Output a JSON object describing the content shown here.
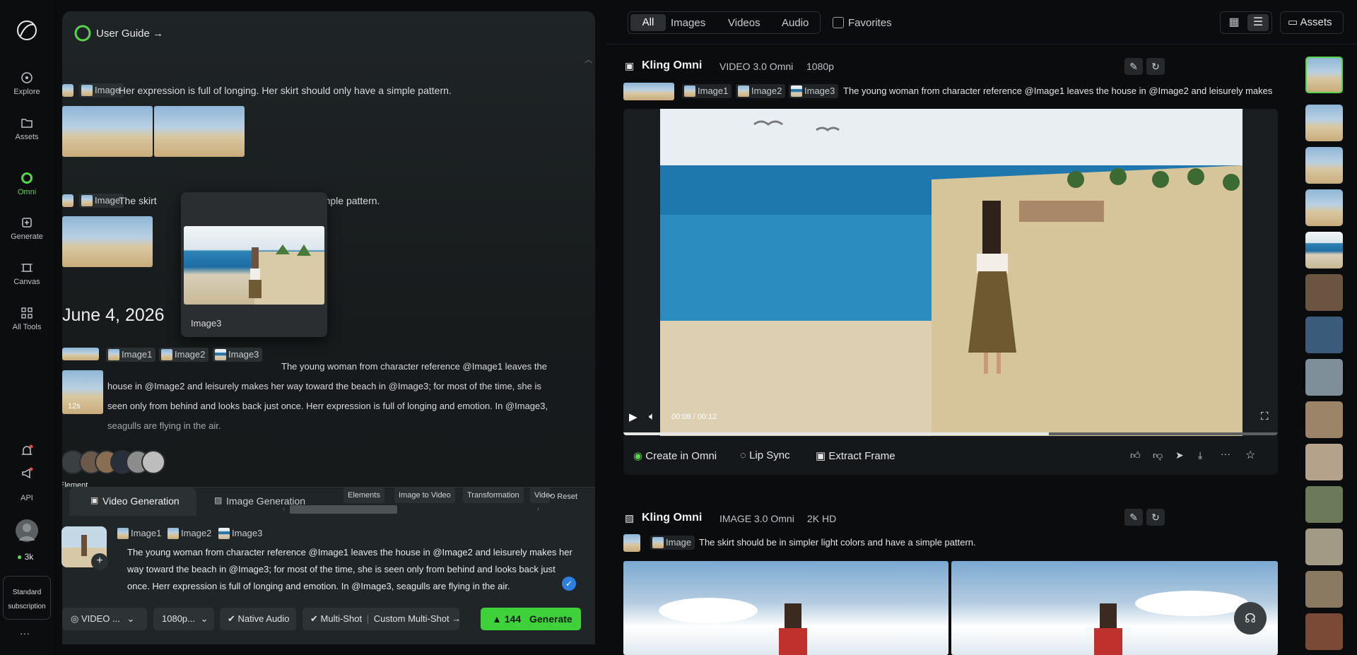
{
  "rail": {
    "items": [
      {
        "label": "Explore",
        "icon": "compass-icon"
      },
      {
        "label": "Assets",
        "icon": "folder-icon"
      },
      {
        "label": "Omni",
        "icon": "omni-icon"
      },
      {
        "label": "Generate",
        "icon": "generate-icon"
      },
      {
        "label": "Canvas",
        "icon": "canvas-icon"
      },
      {
        "label": "All Tools",
        "icon": "grid-icon"
      }
    ],
    "api_label": "API",
    "credits": "3k",
    "subscription_line1": "Standard",
    "subscription_line2": "subscription",
    "more": "···"
  },
  "panel": {
    "user_guide": "User Guide →",
    "history": [
      {
        "chip": "Image",
        "prompt": "Her expression is full of longing. Her skirt should only have a simple pattern."
      },
      {
        "chip": "Image",
        "prompt_start": "The skirt",
        "prompt_end": "d have a simple pattern."
      }
    ],
    "date_heading": "June 4, 2026",
    "tooltip_label": "Image3",
    "task_chips": [
      "Image1",
      "Image2",
      "Image3"
    ],
    "task_prompt_line1": "The young woman from character reference @Image1 leaves the",
    "task_prompt_line2": "house in @Image2 and leisurely makes her way toward the beach in @Image3; for most of the time, she is",
    "task_prompt_line3": "seen only from behind and looks back just once. Herr expression is full of longing and emotion. In @Image3,",
    "task_prompt_line4": "seagulls are flying in the air.",
    "task_duration": "12s",
    "element_label": "Element"
  },
  "composer": {
    "tabs": [
      "Video Generation",
      "Image Generation"
    ],
    "modes": [
      "Elements",
      "Image to Video",
      "Transformation",
      "Vide"
    ],
    "reset_label": "Reset",
    "ref_chips": [
      "Image1",
      "Image2",
      "Image3"
    ],
    "prompt_line1": "The young woman from character reference @Image1 leaves the house in @Image2 and leisurely makes her",
    "prompt_line2": "way toward the beach in @Image3; for most of the time, she is seen only from behind and looks back just",
    "prompt_line3": "once. Herr expression is full of longing and emotion. In @Image3, seagulls are flying in the air.",
    "model_select": "VIDEO ...",
    "resolution_select": "1080p...",
    "native_audio": "Native Audio",
    "multi_shot": "Multi-Shot",
    "custom_multi_shot": "Custom Multi-Shot →",
    "generate_cost": "144",
    "generate_label": "Generate"
  },
  "topbar": {
    "filters": [
      "All",
      "Images",
      "Videos",
      "Audio"
    ],
    "active_filter": "All",
    "favorites": "Favorites",
    "assets": "Assets"
  },
  "card1": {
    "title": "Kling Omni",
    "model": "VIDEO 3.0 Omni",
    "resolution": "1080p",
    "chips": [
      "Image1",
      "Image2",
      "Image3"
    ],
    "prompt": "The young woman from character reference @Image1 leaves the house in @Image2 and leisurely makes",
    "time": "00:08 / 00:12",
    "progress": 0.65,
    "actions": [
      "Create in Omni",
      "Lip Sync",
      "Extract Frame"
    ]
  },
  "card2": {
    "title": "Kling Omni",
    "model": "IMAGE 3.0 Omni",
    "resolution": "2K HD",
    "chip": "Image",
    "prompt": "The skirt should be in simpler light colors and have a simple pattern."
  },
  "colors": {
    "accent": "#57d34c",
    "generate_bg": "#3ed13a",
    "panel_bg": "#1c2123",
    "page_bg": "#0a0c0d"
  }
}
